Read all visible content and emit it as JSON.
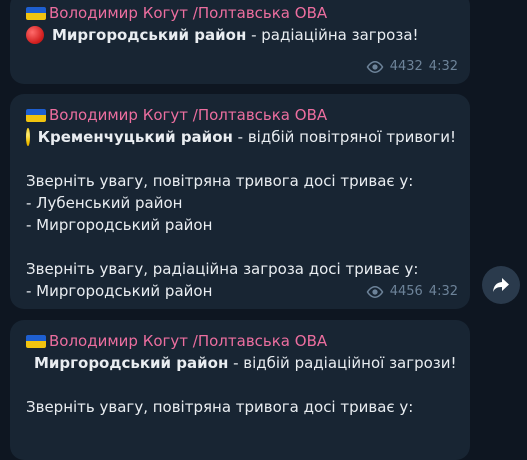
{
  "messages": [
    {
      "sender": "Володимир Когут /Полтавська ОВА",
      "headline_bold": "Миргородський район",
      "headline_rest": " - радіаційна загроза!",
      "views": "4432",
      "time": "4:32"
    },
    {
      "sender": "Володимир Когут /Полтавська ОВА",
      "headline_bold": "Кременчуцький район",
      "headline_rest": " - відбій повітряної тривоги!",
      "body": [
        "Зверніть увагу, повітряна тривога досі триває у:",
        "- Лубенський район",
        "- Миргородський район",
        "",
        "Зверніть увагу, радіаційна загроза досі триває у:",
        "- Миргородський район"
      ],
      "views": "4456",
      "time": "4:32"
    },
    {
      "sender": "Володимир Когут /Полтавська ОВА",
      "headline_bold": "Миргородський район",
      "headline_rest": " - відбій радіаційної загрози!",
      "body": [
        "Зверніть увагу, повітряна тривога досі триває у:"
      ]
    }
  ],
  "icons": {
    "flag": "ukraine-flag-icon",
    "status_red": "red-circle-icon",
    "status_yellow": "yellow-circle-icon",
    "views": "eye-icon",
    "share": "share-arrow-icon"
  },
  "colors": {
    "background": "#0e1621",
    "bubble": "#182533",
    "sender": "#ec6e9f",
    "meta": "#6d8399"
  }
}
